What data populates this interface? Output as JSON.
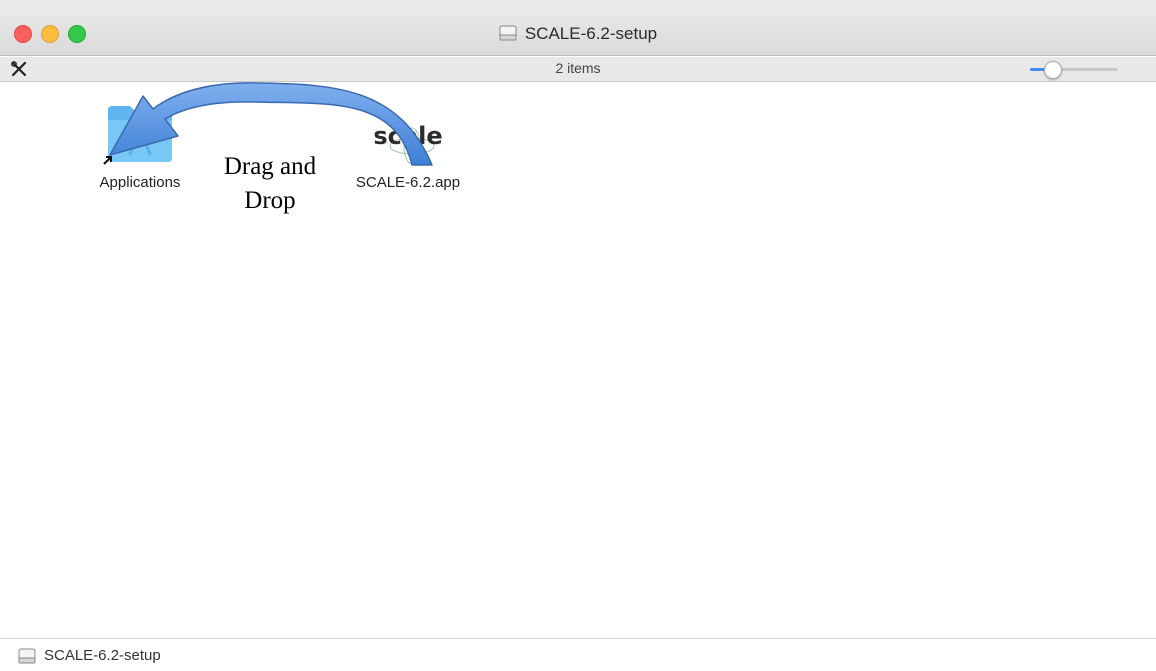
{
  "window": {
    "title": "SCALE-6.2-setup",
    "item_count": "2 items"
  },
  "files": [
    {
      "name": "Applications",
      "icon": "applications-folder-icon",
      "alias": true
    },
    {
      "name": "SCALE-6.2.app",
      "icon": "scale-app-icon",
      "icon_text": "scale"
    }
  ],
  "annotation": {
    "line1": "Drag and",
    "line2": "Drop",
    "arrow_color": "#3f7fd6"
  },
  "path_bar": {
    "label": "SCALE-6.2-setup",
    "icon": "disk-image-icon"
  },
  "colors": {
    "close": "#fc605c",
    "minimize": "#fdbc40",
    "maximize": "#34c84a",
    "accent": "#3e8ef7"
  },
  "icon_size_slider": {
    "value_fraction": 0.2
  }
}
